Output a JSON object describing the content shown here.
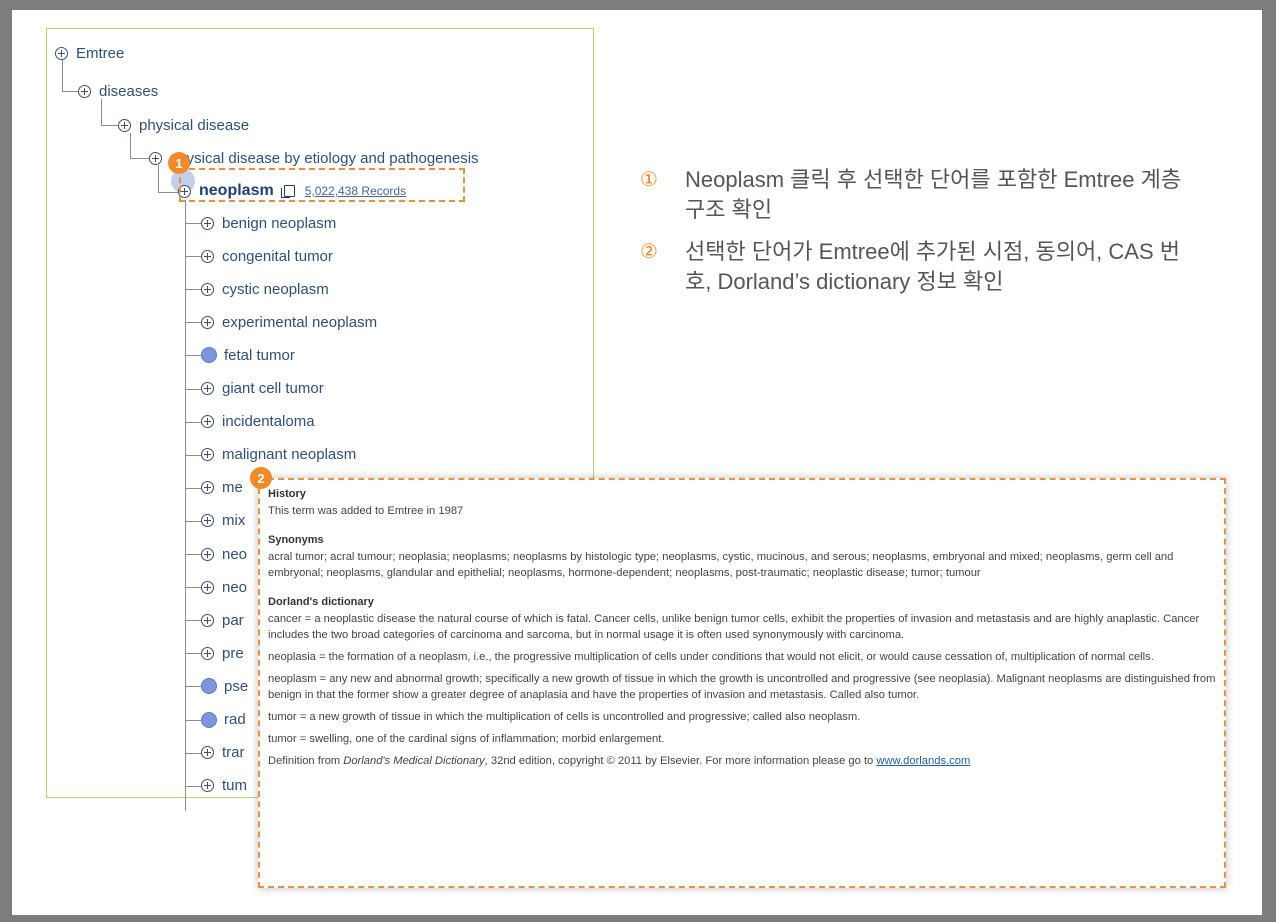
{
  "tree": {
    "root": "Emtree",
    "level1": "diseases",
    "level2": "physical disease",
    "level3": "physical disease by etiology and pathogenesis",
    "selected": {
      "label": "neoplasm",
      "records": "5,022,438 Records"
    },
    "children": [
      {
        "label": "benign neoplasm",
        "type": "expand"
      },
      {
        "label": "congenital tumor",
        "type": "expand"
      },
      {
        "label": "cystic neoplasm",
        "type": "expand"
      },
      {
        "label": "experimental neoplasm",
        "type": "expand"
      },
      {
        "label": "fetal tumor",
        "type": "leaf"
      },
      {
        "label": "giant cell tumor",
        "type": "expand"
      },
      {
        "label": "incidentaloma",
        "type": "expand"
      },
      {
        "label": "malignant neoplasm",
        "type": "expand"
      },
      {
        "label": "me",
        "type": "expand"
      },
      {
        "label": "mix",
        "type": "expand"
      },
      {
        "label": "neo",
        "type": "expand"
      },
      {
        "label": "neo",
        "type": "expand"
      },
      {
        "label": "par",
        "type": "expand"
      },
      {
        "label": "pre",
        "type": "expand"
      },
      {
        "label": "pse",
        "type": "leaf"
      },
      {
        "label": "rad",
        "type": "leaf"
      },
      {
        "label": "trar",
        "type": "expand"
      },
      {
        "label": "tum",
        "type": "expand"
      }
    ]
  },
  "badges": {
    "one": "1",
    "two": "2"
  },
  "notes": [
    {
      "num": "①",
      "text": "Neoplasm 클릭 후 선택한 단어를 포함한 Emtree 계층 구조 확인"
    },
    {
      "num": "②",
      "text": "선택한 단어가 Emtree에 추가된 시점, 동의어, CAS 번호, Dorland’s dictionary 정보 확인"
    }
  ],
  "popup": {
    "history_title": "History",
    "history_text": "This term was added to Emtree in 1987",
    "synonyms_title": "Synonyms",
    "synonyms_text": "acral tumor; acral tumour; neoplasia; neoplasms; neoplasms by histologic type; neoplasms, cystic, mucinous, and serous; neoplasms, embryonal and mixed; neoplasms, germ cell and embryonal; neoplasms, glandular and epithelial; neoplasms, hormone-dependent; neoplasms, post-traumatic; neoplastic disease; tumor; tumour",
    "dorland_title": "Dorland's dictionary",
    "definitions": [
      "cancer = a neoplastic disease the natural course of which is fatal. Cancer cells, unlike benign tumor cells, exhibit the properties of invasion and metastasis and are highly anaplastic. Cancer includes the two broad categories of carcinoma and sarcoma, but in normal usage it is often used synonymously with carcinoma.",
      "neoplasia = the formation of a neoplasm, i.e., the progressive multiplication of cells under conditions that would not elicit, or would cause cessation of, multiplication of normal cells.",
      "neoplasm = any new and abnormal growth; specifically a new growth of tissue in which the growth is uncontrolled and progressive (see neoplasia). Malignant neoplasms are distinguished from benign in that the former show a greater degree of anaplasia and have the properties of invasion and metastasis. Called also tumor.",
      "tumor = a new growth of tissue in which the multiplication of cells is uncontrolled and progressive; called also neoplasm.",
      "tumor = swelling, one of the cardinal signs of inflammation; morbid enlargement."
    ],
    "source_prefix": "Definition from ",
    "source_book": "Dorland's Medical Dictionary",
    "source_suffix": ", 32nd edition, copyright © 2011 by Elsevier. For more information please go to ",
    "source_link": "www.dorlands.com"
  }
}
